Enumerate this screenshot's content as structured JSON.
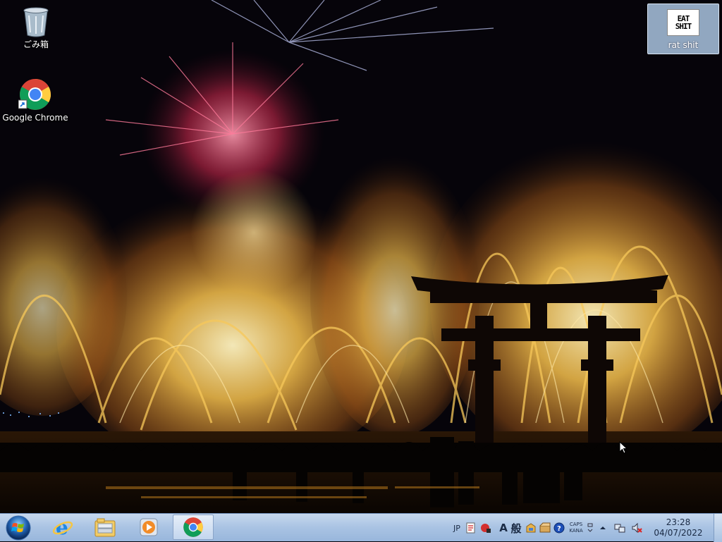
{
  "desktop": {
    "icons": [
      {
        "label": "ごみ箱",
        "icon": "recycle-bin-icon"
      },
      {
        "label": "Google Chrome",
        "icon": "chrome-icon"
      },
      {
        "label": "rat shit",
        "icon": "image-file-icon",
        "thumbnail_text": "EAT SHIT"
      }
    ]
  },
  "taskbar": {
    "start": {
      "icon": "windows-start-orb-icon"
    },
    "pinned": [
      {
        "name": "Internet Explorer",
        "icon": "internet-explorer-icon"
      },
      {
        "name": "Windows Explorer",
        "icon": "folder-library-icon"
      },
      {
        "name": "Windows Media Player",
        "icon": "media-player-icon"
      },
      {
        "name": "Google Chrome",
        "icon": "chrome-icon",
        "active": true
      }
    ],
    "tray": {
      "language": "JP",
      "ime_mode_a": "A",
      "ime_mode_han": "般",
      "caps": "CAPS",
      "kana": "KANA",
      "time": "23:28",
      "date": "04/07/2022"
    }
  },
  "colors": {
    "taskbar_top": "#c6d8ee",
    "taskbar_bottom": "#98b6dc",
    "firework_gold": "#f2b640",
    "firework_red": "#d8305a",
    "torii": "#0e0705"
  }
}
